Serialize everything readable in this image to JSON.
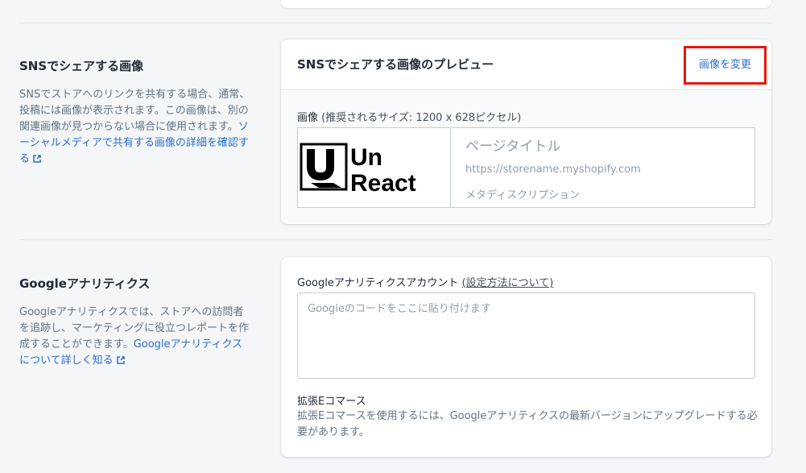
{
  "sns": {
    "title": "SNSでシェアする画像",
    "description": "SNSでストアへのリンクを共有する場合、通常、投稿には画像が表示されます。この画像は、別の関連画像が見つからない場合に使用されます。",
    "link": "ソーシャルメディアで共有する画像の詳細を確認する",
    "card_title": "SNSでシェアする画像のプレビュー",
    "change_image": "画像を変更",
    "image_label": "画像",
    "image_hint": "(推奨されるサイズ: 1200 x 628ピクセル)",
    "logo_line1": "Un",
    "logo_line2": "React",
    "preview_title": "ページタイトル",
    "preview_url": "https://storename.myshopify.com",
    "preview_meta": "メタディスクリプション"
  },
  "ga": {
    "title": "Googleアナリティクス",
    "description": "Googleアナリティクスでは、ストアへの訪問者を追跡し、マーケティングに役立つレポートを作成することができます。",
    "link": "Googleアナリティクスについて詳しく知る",
    "account_label": "Googleアナリティクスアカウント",
    "help_link": "(設定方法について)",
    "placeholder": "Googleのコードをここに貼り付けます",
    "ecommerce_title": "拡張Eコマース",
    "ecommerce_desc": "拡張Eコマースを使用するには、Googleアナリティクスの最新バージョンにアップグレードする必要があります。"
  },
  "colors": {
    "link": "#2c6ecb",
    "highlight": "#e8170b",
    "background": "#f4f6f8"
  },
  "icons": [
    "external-link-icon"
  ]
}
